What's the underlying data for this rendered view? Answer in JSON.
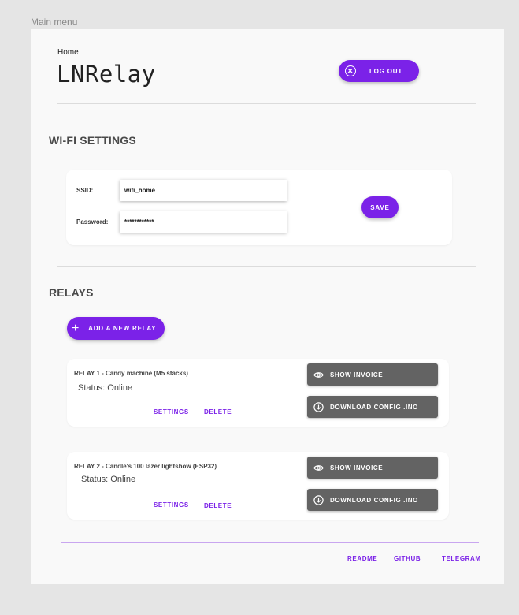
{
  "frame_label": "Main menu",
  "header": {
    "breadcrumb": "Home",
    "title": "LNRelay",
    "logout_label": "LOG OUT"
  },
  "wifi": {
    "section_title": "WI-FI SETTINGS",
    "ssid_label": "SSID:",
    "ssid_value": "wifi_home",
    "password_label": "Password:",
    "password_value": "************",
    "save_label": "SAVE"
  },
  "relays": {
    "section_title": "RELAYS",
    "add_label": "ADD A NEW RELAY",
    "items": [
      {
        "name": "RELAY 1",
        "desc": "- Candy machine (M5 stacks)",
        "status": "Status: Online",
        "settings_label": "SETTINGS",
        "delete_label": "DELETE",
        "invoice_label": "SHOW INVOICE",
        "download_label": "DOWNLOAD CONFIG .INO"
      },
      {
        "name": "RELAY 2",
        "desc": "- Candle's 100 lazer lightshow (ESP32)",
        "status": "Status: Online",
        "settings_label": "SETTINGS",
        "delete_label": "DELETE",
        "invoice_label": "SHOW INVOICE",
        "download_label": "DOWNLOAD CONFIG .INO"
      }
    ]
  },
  "footer": {
    "links": [
      "README",
      "GITHUB",
      "TELEGRAM"
    ]
  },
  "colors": {
    "accent": "#7b22e8",
    "button_grey": "#636363",
    "footer_line": "#c9a6f0"
  },
  "icons": {
    "logout": "close-circle-icon",
    "add": "plus-icon",
    "invoice": "eye-icon",
    "download": "download-circle-icon"
  }
}
